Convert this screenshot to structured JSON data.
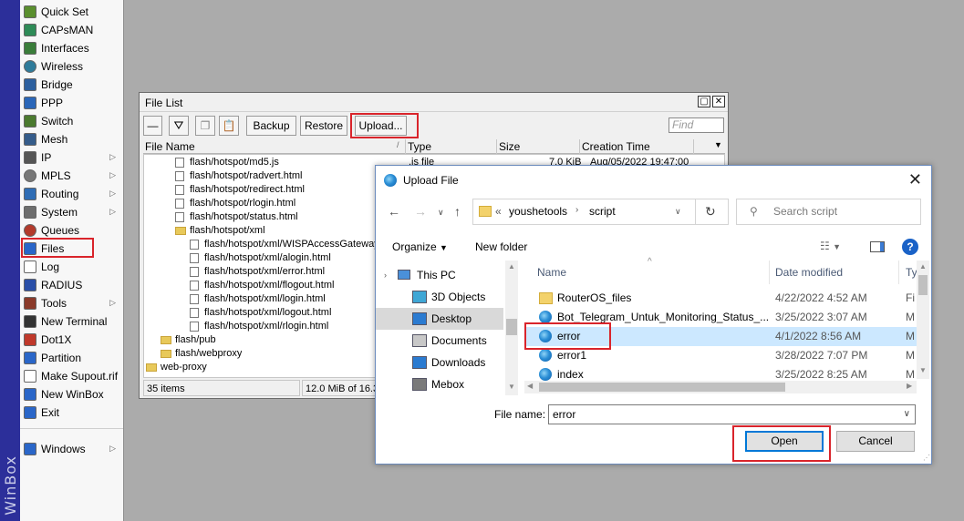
{
  "app": {
    "brand": "WinBox"
  },
  "sidebar": {
    "items": [
      {
        "label": "Quick Set",
        "icon": "quick-set-icon",
        "color": "#5a8f2e",
        "arrow": false
      },
      {
        "label": "CAPsMAN",
        "icon": "capsman-icon",
        "color": "#2e8b57",
        "arrow": false
      },
      {
        "label": "Interfaces",
        "icon": "interfaces-icon",
        "color": "#3a7d3a",
        "arrow": false
      },
      {
        "label": "Wireless",
        "icon": "wireless-icon",
        "color": "#2e7b9a",
        "arrow": false
      },
      {
        "label": "Bridge",
        "icon": "bridge-icon",
        "color": "#2c5f9e",
        "arrow": false
      },
      {
        "label": "PPP",
        "icon": "ppp-icon",
        "color": "#2a66b8",
        "arrow": false
      },
      {
        "label": "Switch",
        "icon": "switch-icon",
        "color": "#4b7a2f",
        "arrow": false
      },
      {
        "label": "Mesh",
        "icon": "mesh-icon",
        "color": "#355c8a",
        "arrow": false
      },
      {
        "label": "IP",
        "icon": "ip-icon",
        "color": "#555555",
        "arrow": true
      },
      {
        "label": "MPLS",
        "icon": "mpls-icon",
        "color": "#777777",
        "arrow": true
      },
      {
        "label": "Routing",
        "icon": "routing-icon",
        "color": "#2f6db5",
        "arrow": true
      },
      {
        "label": "System",
        "icon": "system-icon",
        "color": "#6d6d6d",
        "arrow": true
      },
      {
        "label": "Queues",
        "icon": "queues-icon",
        "color": "#b33a2b",
        "arrow": false
      },
      {
        "label": "Files",
        "icon": "files-icon",
        "color": "#2a66c8",
        "arrow": false
      },
      {
        "label": "Log",
        "icon": "log-icon",
        "color": "#ffffff",
        "arrow": false
      },
      {
        "label": "RADIUS",
        "icon": "radius-icon",
        "color": "#2a4fa8",
        "arrow": false
      },
      {
        "label": "Tools",
        "icon": "tools-icon",
        "color": "#8a3a2a",
        "arrow": true
      },
      {
        "label": "New Terminal",
        "icon": "terminal-icon",
        "color": "#333333",
        "arrow": false
      },
      {
        "label": "Dot1X",
        "icon": "dot1x-icon",
        "color": "#c0392b",
        "arrow": false
      },
      {
        "label": "Partition",
        "icon": "partition-icon",
        "color": "#2a66c8",
        "arrow": false
      },
      {
        "label": "Make Supout.rif",
        "icon": "supout-icon",
        "color": "#ffffff",
        "arrow": false
      },
      {
        "label": "New WinBox",
        "icon": "winbox-icon",
        "color": "#2a66c8",
        "arrow": false
      },
      {
        "label": "Exit",
        "icon": "exit-icon",
        "color": "#2a66c8",
        "arrow": false
      },
      {
        "label": "Windows",
        "icon": "windows-icon",
        "color": "#2a66c8",
        "arrow": true
      }
    ]
  },
  "file_list": {
    "title": "File List",
    "buttons": {
      "backup": "Backup",
      "restore": "Restore",
      "upload": "Upload..."
    },
    "find_placeholder": "Find",
    "columns": {
      "name": "File Name",
      "type": "Type",
      "size": "Size",
      "created": "Creation Time"
    },
    "rows": [
      {
        "name": "flash/hotspot/md5.js",
        "kind": "file",
        "indent": 2,
        "type": ".js file",
        "size": "7.0 KiB",
        "created": "Aug/05/2022 19:47:00"
      },
      {
        "name": "flash/hotspot/radvert.html",
        "kind": "file",
        "indent": 2,
        "type": "",
        "size": "",
        "created": ""
      },
      {
        "name": "flash/hotspot/redirect.html",
        "kind": "file",
        "indent": 2,
        "type": "",
        "size": "",
        "created": ""
      },
      {
        "name": "flash/hotspot/rlogin.html",
        "kind": "file",
        "indent": 2,
        "type": "",
        "size": "",
        "created": ""
      },
      {
        "name": "flash/hotspot/status.html",
        "kind": "file",
        "indent": 2,
        "type": "",
        "size": "",
        "created": ""
      },
      {
        "name": "flash/hotspot/xml",
        "kind": "folder",
        "indent": 2,
        "type": "",
        "size": "",
        "created": ""
      },
      {
        "name": "flash/hotspot/xml/WISPAccessGatewayParam.xsd",
        "kind": "file",
        "indent": 3,
        "type": "",
        "size": "",
        "created": ""
      },
      {
        "name": "flash/hotspot/xml/alogin.html",
        "kind": "file",
        "indent": 3,
        "type": "",
        "size": "",
        "created": ""
      },
      {
        "name": "flash/hotspot/xml/error.html",
        "kind": "file",
        "indent": 3,
        "type": "",
        "size": "",
        "created": ""
      },
      {
        "name": "flash/hotspot/xml/flogout.html",
        "kind": "file",
        "indent": 3,
        "type": "",
        "size": "",
        "created": ""
      },
      {
        "name": "flash/hotspot/xml/login.html",
        "kind": "file",
        "indent": 3,
        "type": "",
        "size": "",
        "created": ""
      },
      {
        "name": "flash/hotspot/xml/logout.html",
        "kind": "file",
        "indent": 3,
        "type": "",
        "size": "",
        "created": ""
      },
      {
        "name": "flash/hotspot/xml/rlogin.html",
        "kind": "file",
        "indent": 3,
        "type": "",
        "size": "",
        "created": ""
      },
      {
        "name": "flash/pub",
        "kind": "folder",
        "indent": 1,
        "type": "",
        "size": "",
        "created": ""
      },
      {
        "name": "flash/webproxy",
        "kind": "folder",
        "indent": 1,
        "type": "",
        "size": "",
        "created": ""
      },
      {
        "name": "web-proxy",
        "kind": "folder",
        "indent": 0,
        "type": "",
        "size": "",
        "created": ""
      }
    ],
    "status": {
      "items": "35 items",
      "free": "12.0 MiB of 16.3"
    }
  },
  "dialog": {
    "title": "Upload File",
    "path": [
      "youshetools",
      "script"
    ],
    "path_prefix": "«",
    "search_placeholder": "Search script",
    "organize": "Organize",
    "new_folder": "New folder",
    "nav": [
      {
        "label": "This PC",
        "icon": "pc-icon"
      },
      {
        "label": "3D Objects",
        "icon": "cube-icon"
      },
      {
        "label": "Desktop",
        "icon": "desktop-icon"
      },
      {
        "label": "Documents",
        "icon": "documents-icon"
      },
      {
        "label": "Downloads",
        "icon": "downloads-icon"
      },
      {
        "label": "Mebox",
        "icon": "mebox-icon"
      }
    ],
    "columns": {
      "name": "Name",
      "date": "Date modified",
      "type": "Ty"
    },
    "files": [
      {
        "name": "RouterOS_files",
        "date": "4/22/2022 4:52 AM",
        "type": "Fi",
        "icon": "folder-icon"
      },
      {
        "name": "Bot_Telegram_Untuk_Monitoring_Status_...",
        "date": "3/25/2022 3:07 AM",
        "type": "M",
        "icon": "edge-icon"
      },
      {
        "name": "error",
        "date": "4/1/2022 8:56 AM",
        "type": "M",
        "icon": "edge-icon"
      },
      {
        "name": "error1",
        "date": "3/28/2022 7:07 PM",
        "type": "M",
        "icon": "edge-icon"
      },
      {
        "name": "index",
        "date": "3/25/2022 8:25 AM",
        "type": "M",
        "icon": "edge-icon"
      }
    ],
    "file_name_label": "File name:",
    "file_name_value": "error",
    "open": "Open",
    "cancel": "Cancel"
  },
  "colors": {
    "highlight": "#d9242b",
    "winbox_bar": "#2c2f9a",
    "selection": "#cce8ff"
  }
}
